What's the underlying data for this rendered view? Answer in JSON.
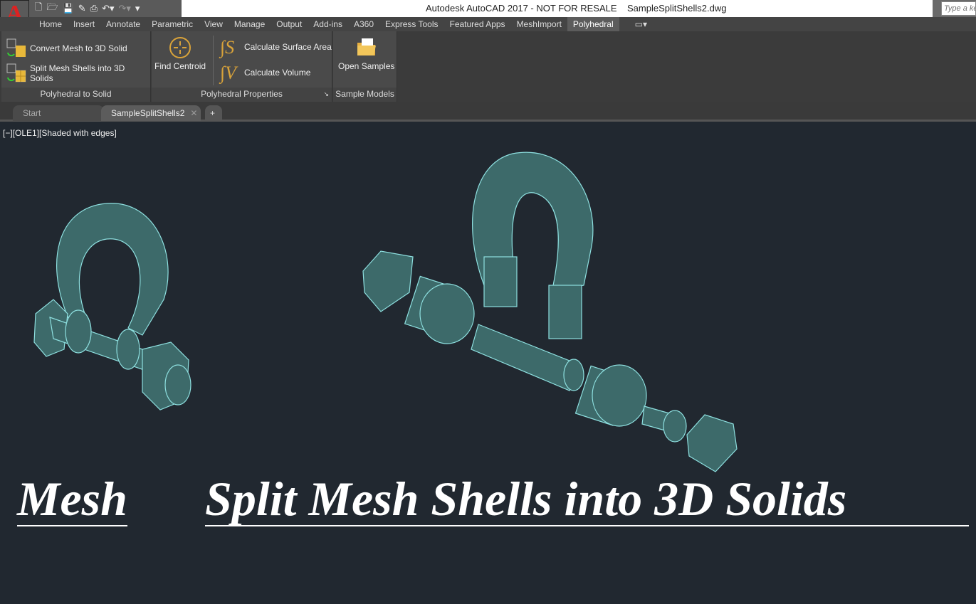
{
  "app": {
    "logo": "A",
    "title": "Autodesk AutoCAD 2017 - NOT FOR RESALE    SampleSplitShells2.dwg",
    "search_placeholder": "Type a keyword"
  },
  "qat": {
    "icons": [
      "new-icon",
      "open-icon",
      "save-icon",
      "save-as-icon",
      "print-icon",
      "undo-icon",
      "redo-icon",
      "customize-icon"
    ]
  },
  "ribbon_tabs": [
    "Home",
    "Insert",
    "Annotate",
    "Parametric",
    "View",
    "Manage",
    "Output",
    "Add-ins",
    "A360",
    "Express Tools",
    "Featured Apps",
    "MeshImport",
    "Polyhedral"
  ],
  "active_tab": "Polyhedral",
  "panels": {
    "to_solid": {
      "label": "Polyhedral to Solid",
      "convert": "Convert Mesh to 3D Solid",
      "split": "Split Mesh Shells into 3D Solids"
    },
    "properties": {
      "label": "Polyhedral Properties",
      "centroid": "Find Centroid",
      "surface": "Calculate Surface Area",
      "volume": "Calculate Volume"
    },
    "samples": {
      "label": "Sample Models",
      "open": "Open Samples"
    }
  },
  "doc_tabs": [
    {
      "label": "Start"
    },
    {
      "label": "SampleSplitShells2"
    }
  ],
  "viewport": {
    "label": "[−][OLE1][Shaded with edges]",
    "caption_left": "Mesh",
    "caption_right": "Split Mesh Shells into 3D Solids"
  },
  "colors": {
    "accent": "#d22",
    "model_fill": "#3d6a6a",
    "model_edge": "#8ee0e0",
    "viewport_bg": "#212830"
  }
}
